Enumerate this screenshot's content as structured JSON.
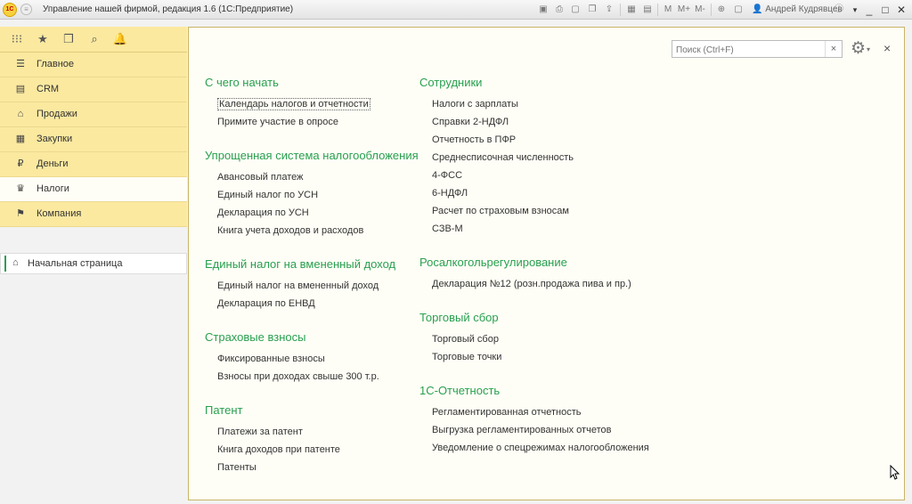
{
  "app": {
    "title": "Управление нашей фирмой, редакция 1.6  (1С:Предприятие)",
    "logo_text": "1С",
    "user": "Андрей Кудрявцев",
    "toolbar_m": [
      "M",
      "M+",
      "M-"
    ]
  },
  "sidebar": {
    "top_icons": [
      "apps-icon",
      "star-icon",
      "history-icon",
      "search-icon",
      "bell-icon"
    ],
    "items": [
      {
        "label": "Главное",
        "icon": "☰"
      },
      {
        "label": "CRM",
        "icon": "▤"
      },
      {
        "label": "Продажи",
        "icon": "⌂"
      },
      {
        "label": "Закупки",
        "icon": "▦"
      },
      {
        "label": "Деньги",
        "icon": "₽"
      },
      {
        "label": "Налоги",
        "icon": "♛"
      },
      {
        "label": "Компания",
        "icon": "⚑"
      }
    ],
    "open_window": "Начальная страница"
  },
  "main": {
    "search_placeholder": "Поиск (Ctrl+F)",
    "left_sections": [
      {
        "title": "С чего начать",
        "links": [
          "Календарь налогов и отчетности",
          "Примите участие в опросе"
        ]
      },
      {
        "title": "Упрощенная система налогообложения",
        "links": [
          "Авансовый платеж",
          "Единый налог по УСН",
          "Декларация по УСН",
          "Книга учета доходов и расходов"
        ]
      },
      {
        "title": "Единый налог на вмененный доход",
        "links": [
          "Единый налог на вмененный доход",
          "Декларация по ЕНВД"
        ]
      },
      {
        "title": "Страховые взносы",
        "links": [
          "Фиксированные взносы",
          "Взносы при доходах свыше 300 т.р."
        ]
      },
      {
        "title": "Патент",
        "links": [
          "Платежи за патент",
          "Книга доходов при патенте",
          "Патенты"
        ]
      }
    ],
    "right_sections": [
      {
        "title": "Сотрудники",
        "links": [
          "Налоги с зарплаты",
          "Справки 2-НДФЛ",
          "Отчетность в ПФР",
          "Среднесписочная численность",
          "4-ФСС",
          "6-НДФЛ",
          "Расчет по страховым взносам",
          "СЗВ-М"
        ]
      },
      {
        "title": "Росалкогольрегулирование",
        "links": [
          "Декларация №12 (розн.продажа пива и пр.)"
        ]
      },
      {
        "title": "Торговый сбор",
        "links": [
          "Торговый сбор",
          "Торговые точки"
        ]
      },
      {
        "title": "1С-Отчетность",
        "links": [
          "Регламентированная отчетность",
          "Выгрузка регламентированных отчетов",
          "Уведомление о спецрежимах налогообложения"
        ]
      }
    ]
  }
}
